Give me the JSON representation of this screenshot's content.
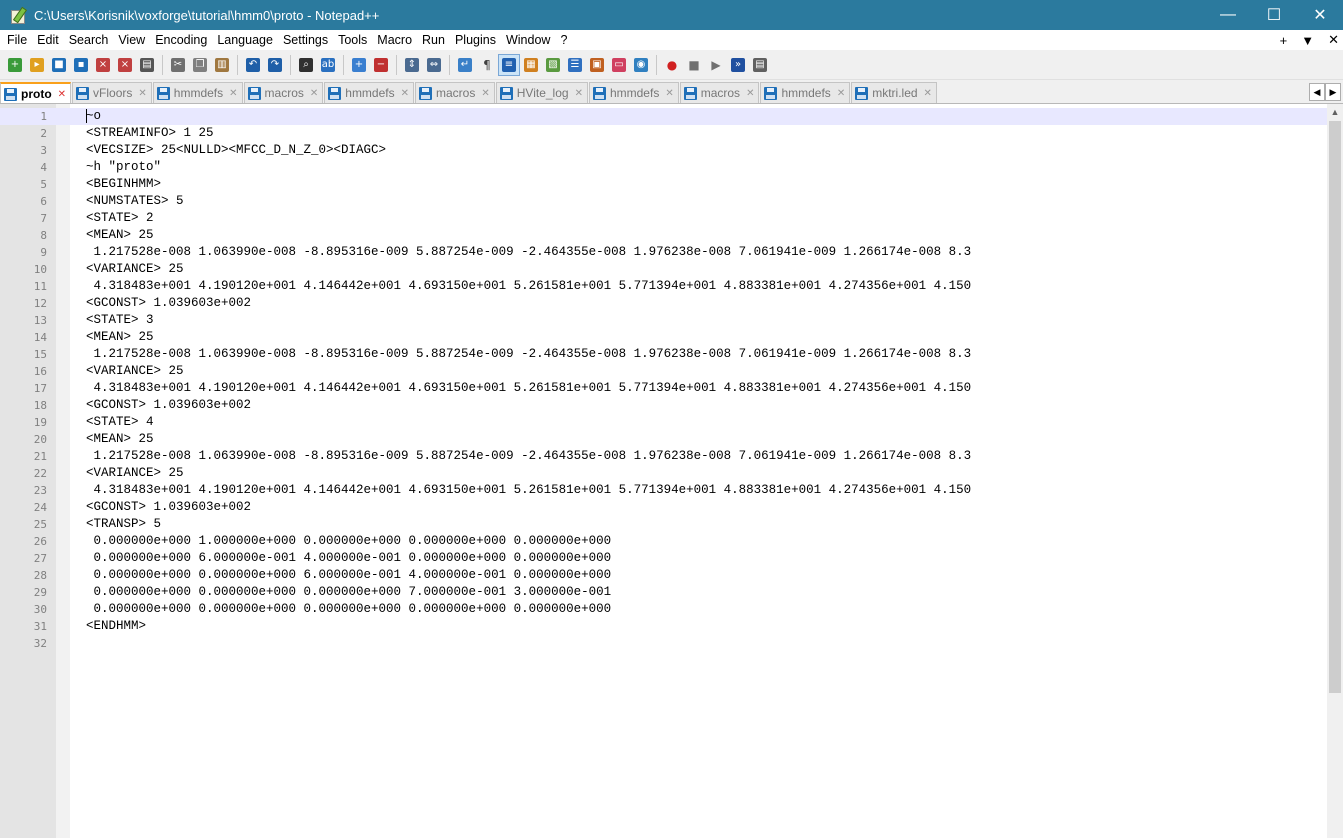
{
  "window": {
    "title": "C:\\Users\\Korisnik\\voxforge\\tutorial\\hmm0\\proto - Notepad++",
    "minimize": "—",
    "maximize": "☐",
    "close": "✕"
  },
  "menu": {
    "items": [
      "File",
      "Edit",
      "Search",
      "View",
      "Encoding",
      "Language",
      "Settings",
      "Tools",
      "Macro",
      "Run",
      "Plugins",
      "Window",
      "?"
    ],
    "right": [
      "+",
      "▼",
      "✕"
    ]
  },
  "toolbar": {
    "buttons": [
      {
        "icon": "new-file-icon",
        "color": "#3a9b3a"
      },
      {
        "icon": "open-file-icon",
        "color": "#e0a020"
      },
      {
        "icon": "save-icon",
        "color": "#1f6fb8"
      },
      {
        "icon": "save-all-icon",
        "color": "#1f6fb8"
      },
      {
        "icon": "close-file-icon",
        "color": "#c04040"
      },
      {
        "icon": "close-all-icon",
        "color": "#c04040"
      },
      {
        "icon": "print-icon",
        "color": "#555555"
      },
      {
        "sep": true
      },
      {
        "icon": "cut-icon",
        "color": "#707070"
      },
      {
        "icon": "copy-icon",
        "color": "#808080"
      },
      {
        "icon": "paste-icon",
        "color": "#a07840"
      },
      {
        "sep": true
      },
      {
        "icon": "undo-icon",
        "color": "#1f5fa8"
      },
      {
        "icon": "redo-icon",
        "color": "#1f5fa8"
      },
      {
        "sep": true
      },
      {
        "icon": "find-icon",
        "color": "#303030"
      },
      {
        "icon": "replace-icon",
        "color": "#2a70c0"
      },
      {
        "sep": true
      },
      {
        "icon": "zoom-in-icon",
        "color": "#3a7fd0"
      },
      {
        "icon": "zoom-out-icon",
        "color": "#c03030"
      },
      {
        "sep": true
      },
      {
        "icon": "sync-vertical-icon",
        "color": "#4a6a90"
      },
      {
        "icon": "sync-horizontal-icon",
        "color": "#4a6a90"
      },
      {
        "sep": true
      },
      {
        "icon": "word-wrap-icon",
        "color": "#3a80c8"
      },
      {
        "icon": "show-all-characters-icon",
        "color": "#404040"
      },
      {
        "icon": "indent-guide-icon",
        "color": "#2060b0",
        "active": true
      },
      {
        "icon": "udl-icon",
        "color": "#d08020"
      },
      {
        "icon": "doc-map-icon",
        "color": "#5a9a40"
      },
      {
        "icon": "function-list-icon",
        "color": "#3070c0"
      },
      {
        "icon": "folder-as-workspace-icon",
        "color": "#c06020"
      },
      {
        "icon": "monitoring-icon",
        "color": "#d04060"
      },
      {
        "icon": "eye-icon",
        "color": "#3080c0"
      },
      {
        "sep": true
      },
      {
        "icon": "record-macro-icon",
        "color": "#d02020"
      },
      {
        "icon": "stop-recording-icon",
        "color": "#707070"
      },
      {
        "icon": "playback-icon",
        "color": "#707070"
      },
      {
        "icon": "run-macro-multiple-icon",
        "color": "#2050a0"
      },
      {
        "icon": "save-macro-icon",
        "color": "#606060"
      }
    ]
  },
  "tabs": [
    {
      "label": "proto",
      "active": true
    },
    {
      "label": "vFloors"
    },
    {
      "label": "hmmdefs"
    },
    {
      "label": "macros"
    },
    {
      "label": "hmmdefs"
    },
    {
      "label": "macros"
    },
    {
      "label": "HVite_log"
    },
    {
      "label": "hmmdefs"
    },
    {
      "label": "macros"
    },
    {
      "label": "hmmdefs"
    },
    {
      "label": "mktri.led"
    }
  ],
  "tab_close_glyph": "✕",
  "tab_scroll": {
    "left": "◀",
    "right": "▶"
  },
  "editor": {
    "lines": [
      "~o",
      "<STREAMINFO> 1 25",
      "<VECSIZE> 25<NULLD><MFCC_D_N_Z_0><DIAGC>",
      "~h \"proto\"",
      "<BEGINHMM>",
      "<NUMSTATES> 5",
      "<STATE> 2",
      "<MEAN> 25",
      " 1.217528e-008 1.063990e-008 -8.895316e-009 5.887254e-009 -2.464355e-008 1.976238e-008 7.061941e-009 1.266174e-008 8.3",
      "<VARIANCE> 25",
      " 4.318483e+001 4.190120e+001 4.146442e+001 4.693150e+001 5.261581e+001 5.771394e+001 4.883381e+001 4.274356e+001 4.150",
      "<GCONST> 1.039603e+002",
      "<STATE> 3",
      "<MEAN> 25",
      " 1.217528e-008 1.063990e-008 -8.895316e-009 5.887254e-009 -2.464355e-008 1.976238e-008 7.061941e-009 1.266174e-008 8.3",
      "<VARIANCE> 25",
      " 4.318483e+001 4.190120e+001 4.146442e+001 4.693150e+001 5.261581e+001 5.771394e+001 4.883381e+001 4.274356e+001 4.150",
      "<GCONST> 1.039603e+002",
      "<STATE> 4",
      "<MEAN> 25",
      " 1.217528e-008 1.063990e-008 -8.895316e-009 5.887254e-009 -2.464355e-008 1.976238e-008 7.061941e-009 1.266174e-008 8.3",
      "<VARIANCE> 25",
      " 4.318483e+001 4.190120e+001 4.146442e+001 4.693150e+001 5.261581e+001 5.771394e+001 4.883381e+001 4.274356e+001 4.150",
      "<GCONST> 1.039603e+002",
      "<TRANSP> 5",
      " 0.000000e+000 1.000000e+000 0.000000e+000 0.000000e+000 0.000000e+000",
      " 0.000000e+000 6.000000e-001 4.000000e-001 0.000000e+000 0.000000e+000",
      " 0.000000e+000 0.000000e+000 6.000000e-001 4.000000e-001 0.000000e+000",
      " 0.000000e+000 0.000000e+000 0.000000e+000 7.000000e-001 3.000000e-001",
      " 0.000000e+000 0.000000e+000 0.000000e+000 0.000000e+000 0.000000e+000",
      "<ENDHMM>",
      ""
    ],
    "current_line": 1
  },
  "scrollbar": {
    "up_arrow": "▲"
  }
}
